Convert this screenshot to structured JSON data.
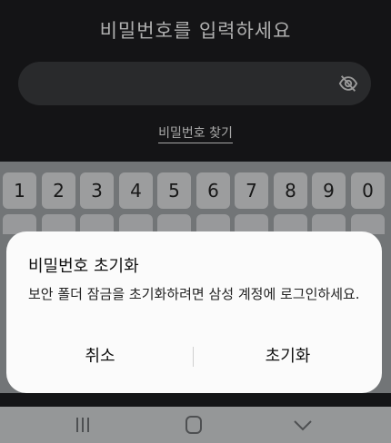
{
  "lock": {
    "prompt": "비밀번호를 입력하세요",
    "find_password": "비밀번호 찾기",
    "visibility_icon": "eye-off-icon"
  },
  "keyboard": {
    "numbers": [
      "1",
      "2",
      "3",
      "4",
      "5",
      "6",
      "7",
      "8",
      "9",
      "0"
    ]
  },
  "dialog": {
    "title": "비밀번호 초기화",
    "message": "보안 폴더 잠금을 초기화하려면 삼성 계정에 로그인하세요.",
    "cancel": "취소",
    "confirm": "초기화"
  },
  "navbar": {
    "recent_icon": "recent-apps-icon",
    "home_icon": "home-icon",
    "back_icon": "back-chevron-icon"
  }
}
